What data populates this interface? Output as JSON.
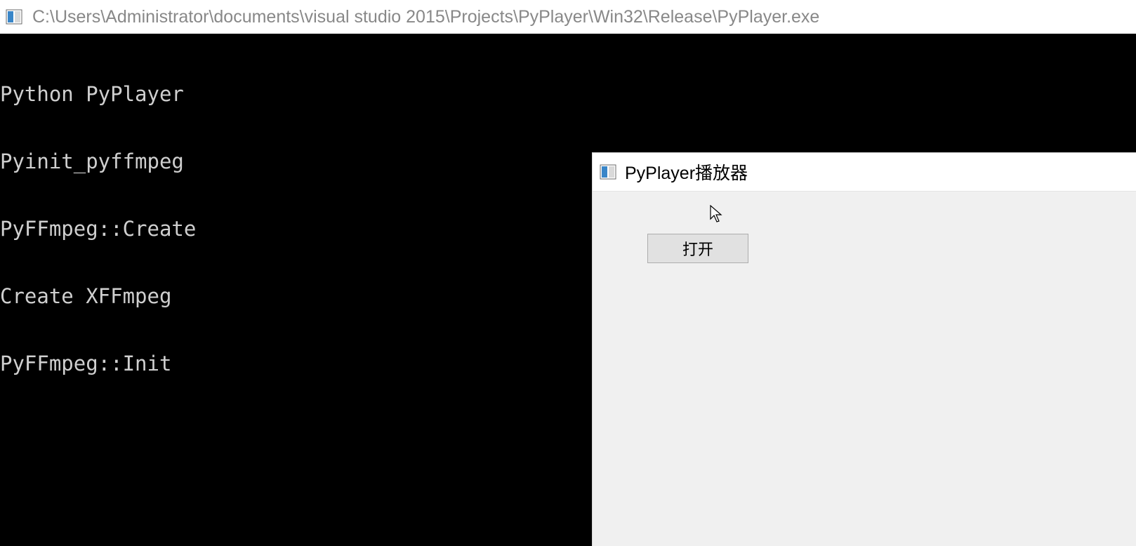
{
  "console": {
    "title": "C:\\Users\\Administrator\\documents\\visual studio 2015\\Projects\\PyPlayer\\Win32\\Release\\PyPlayer.exe",
    "lines": [
      "Python PyPlayer",
      "Pyinit_pyffmpeg",
      "PyFFmpeg::Create",
      "Create XFFmpeg",
      "PyFFmpeg::Init"
    ]
  },
  "dialog": {
    "title": "PyPlayer播放器",
    "open_button_label": "打开"
  }
}
